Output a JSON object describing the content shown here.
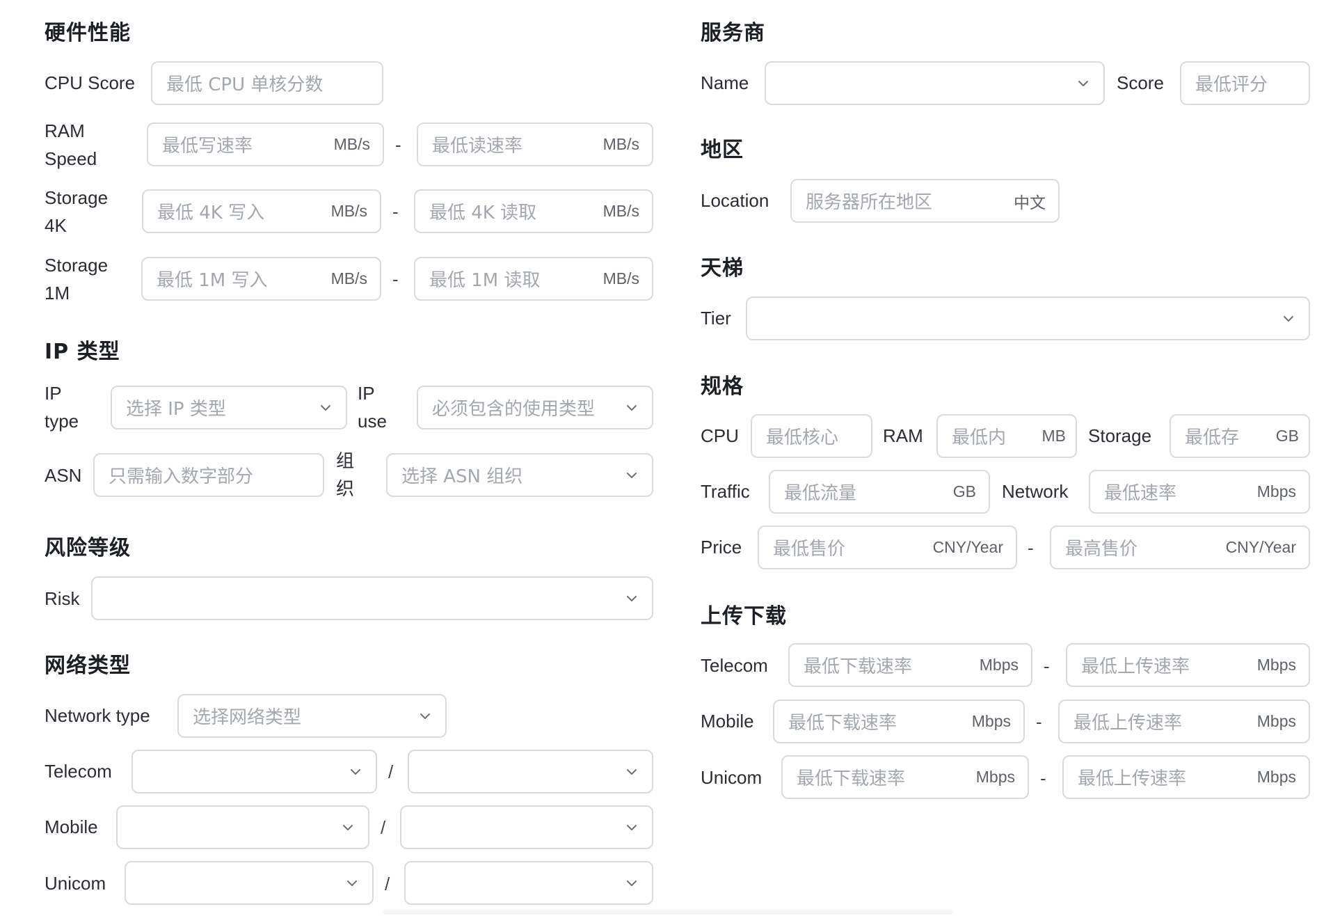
{
  "hardware": {
    "title": "硬件性能",
    "cpu_score": {
      "label": "CPU Score",
      "placeholder": "最低 CPU 单核分数"
    },
    "ram_speed": {
      "label_line1": "RAM",
      "label_line2": "Speed",
      "write_placeholder": "最低写速率",
      "read_placeholder": "最低读速率",
      "unit": "MB/s",
      "separator": "-"
    },
    "storage_4k": {
      "label_line1": "Storage",
      "label_line2": "4K",
      "write_placeholder": "最低 4K 写入",
      "read_placeholder": "最低 4K 读取",
      "unit": "MB/s",
      "separator": "-"
    },
    "storage_1m": {
      "label_line1": "Storage",
      "label_line2": "1M",
      "write_placeholder": "最低 1M 写入",
      "read_placeholder": "最低 1M 读取",
      "unit": "MB/s",
      "separator": "-"
    }
  },
  "ip": {
    "title": "IP 类型",
    "ip_type": {
      "label_line1": "IP",
      "label_line2": "type",
      "placeholder": "选择 IP 类型"
    },
    "ip_use": {
      "label_line1": "IP",
      "label_line2": "use",
      "placeholder": "必须包含的使用类型"
    },
    "asn": {
      "label": "ASN",
      "placeholder": "只需输入数字部分"
    },
    "org": {
      "label_line1": "组",
      "label_line2": "织",
      "placeholder": "选择 ASN 组织"
    }
  },
  "risk": {
    "title": "风险等级",
    "label": "Risk",
    "value": ""
  },
  "network": {
    "title": "网络类型",
    "network_type": {
      "label": "Network type",
      "placeholder": "选择网络类型"
    },
    "rows": [
      {
        "label": "Telecom",
        "left_value": "",
        "right_value": "",
        "separator": "/"
      },
      {
        "label": "Mobile",
        "left_value": "",
        "right_value": "",
        "separator": "/"
      },
      {
        "label": "Unicom",
        "left_value": "",
        "right_value": "",
        "separator": "/"
      }
    ]
  },
  "provider": {
    "title": "服务商",
    "name": {
      "label": "Name",
      "value": ""
    },
    "score": {
      "label": "Score",
      "placeholder": "最低评分"
    }
  },
  "region": {
    "title": "地区",
    "location": {
      "label": "Location",
      "placeholder": "服务器所在地区",
      "suffix": "中文"
    }
  },
  "ladder": {
    "title": "天梯",
    "tier": {
      "label": "Tier",
      "value": ""
    }
  },
  "spec": {
    "title": "规格",
    "cpu": {
      "label": "CPU",
      "placeholder": "最低核心"
    },
    "ram": {
      "label": "RAM",
      "placeholder": "最低内",
      "unit": "MB"
    },
    "storage": {
      "label": "Storage",
      "placeholder": "最低存",
      "unit": "GB"
    },
    "traffic": {
      "label": "Traffic",
      "placeholder": "最低流量",
      "unit": "GB"
    },
    "network": {
      "label": "Network",
      "placeholder": "最低速率",
      "unit": "Mbps"
    },
    "price": {
      "label": "Price",
      "min_placeholder": "最低售价",
      "max_placeholder": "最高售价",
      "unit": "CNY/Year",
      "separator": "-"
    }
  },
  "updown": {
    "title": "上传下载",
    "rows": [
      {
        "label": "Telecom",
        "down_placeholder": "最低下载速率",
        "up_placeholder": "最低上传速率",
        "unit": "Mbps",
        "separator": "-"
      },
      {
        "label": "Mobile",
        "down_placeholder": "最低下载速率",
        "up_placeholder": "最低上传速率",
        "unit": "Mbps",
        "separator": "-"
      },
      {
        "label": "Unicom",
        "down_placeholder": "最低下载速率",
        "up_placeholder": "最低上传速率",
        "unit": "Mbps",
        "separator": "-"
      }
    ]
  },
  "icons": {
    "chevron": "chevron-down-icon"
  }
}
